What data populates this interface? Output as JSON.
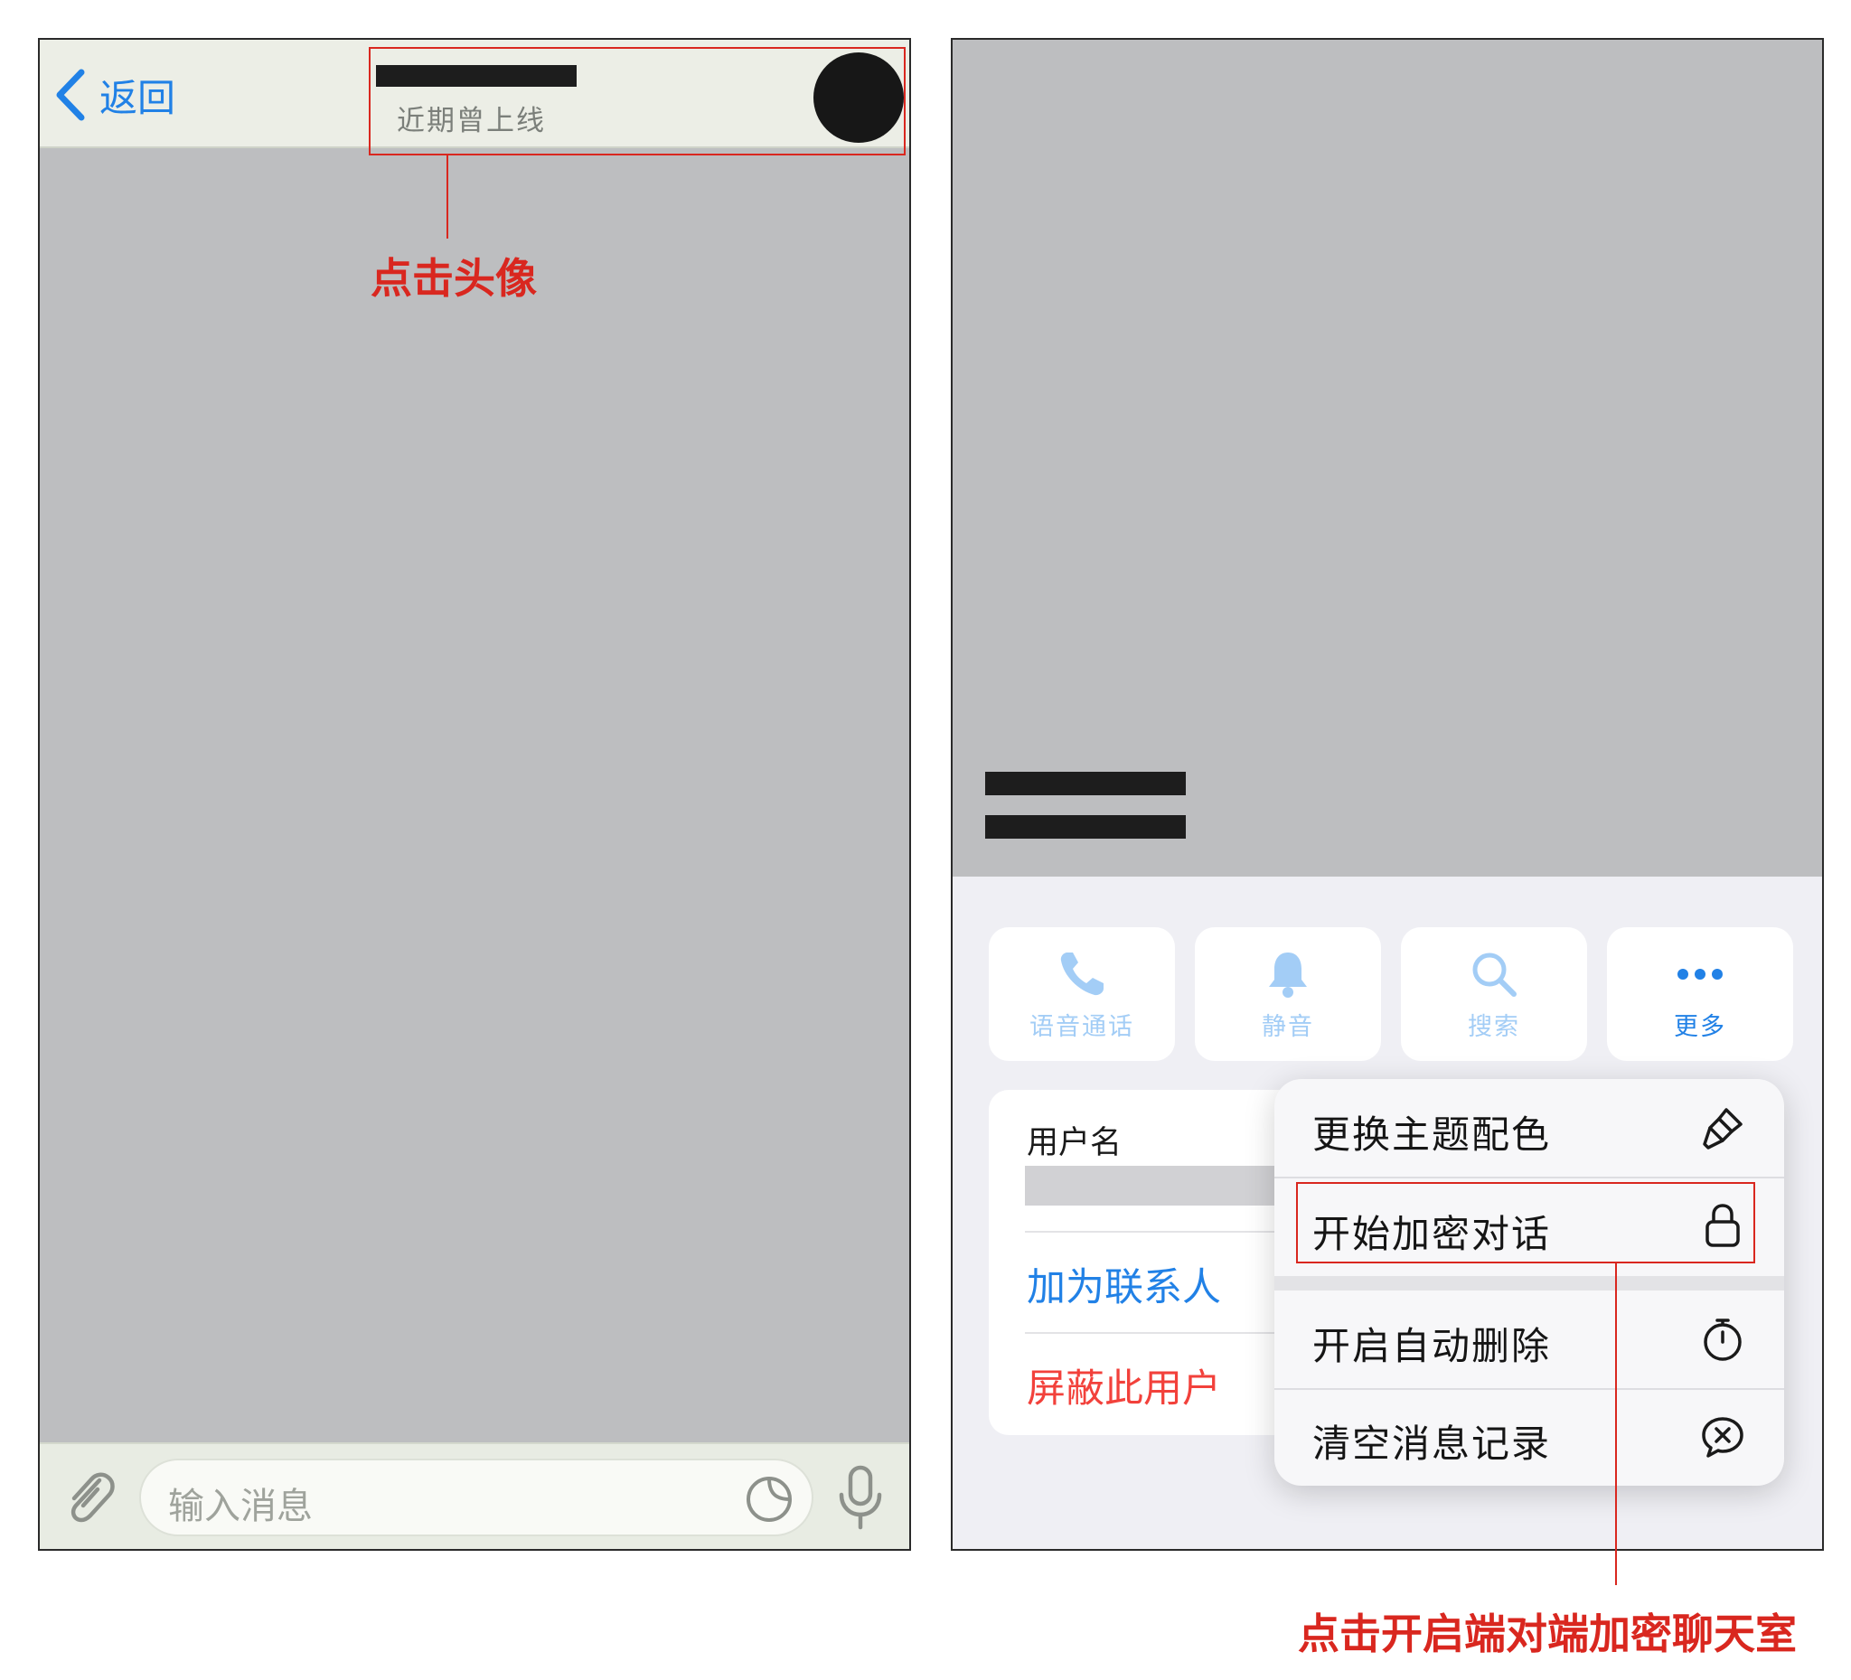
{
  "chat": {
    "back_label": "返回",
    "status": "近期曾上线",
    "input_placeholder": "输入消息"
  },
  "profile": {
    "actions": [
      {
        "label": "语音通话",
        "icon": "phone-icon",
        "enabled": false
      },
      {
        "label": "静音",
        "icon": "bell-icon",
        "enabled": false
      },
      {
        "label": "搜索",
        "icon": "search-icon",
        "enabled": false
      },
      {
        "label": "更多",
        "icon": "more-dots-icon",
        "enabled": true
      }
    ],
    "username_label": "用户名",
    "add_contact": "加为联系人",
    "block_user": "屏蔽此用户"
  },
  "menu": {
    "items": [
      {
        "label": "更换主题配色",
        "icon": "paintbrush-icon"
      },
      {
        "label": "开始加密对话",
        "icon": "lock-icon"
      },
      {
        "label": "开启自动删除",
        "icon": "timer-icon"
      },
      {
        "label": "清空消息记录",
        "icon": "clear-chat-icon"
      }
    ]
  },
  "annotations": {
    "tap_avatar": "点击头像",
    "start_secret_chat": "点击开启端对端加密聊天室"
  },
  "colors": {
    "accent_blue": "#2181e6",
    "disabled_blue": "#a3cdf6",
    "destructive_red": "#f2413b",
    "annotation_red": "#d9271f"
  }
}
